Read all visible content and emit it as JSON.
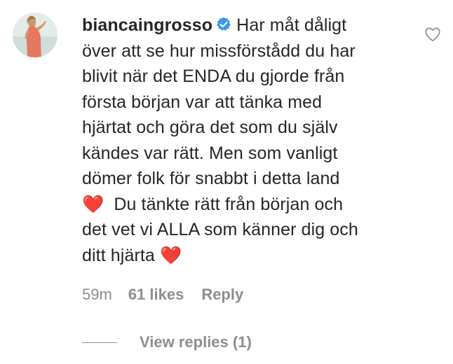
{
  "comment": {
    "username": "biancaingrosso",
    "verified_icon": "verified-badge-icon",
    "text_lines": [
      "Har måt dåligt",
      "över att se hur missförstådd du har",
      "blivit när det ENDA du gjorde från",
      "första början var att tänka med",
      "hjärtat och göra det som du själv",
      "kändes var rätt. Men som vanligt",
      "dömer folk för snabbt i detta land",
      "❤️  Du tänkte rätt från början och",
      "det vet vi ALLA som känner dig och",
      "ditt hjärta ❤️"
    ],
    "time": "59m",
    "likes": "61 likes",
    "reply_label": "Reply",
    "view_replies_label": "View replies (1)",
    "like_icon": "heart-outline-icon",
    "accent_color": "#3897f0",
    "muted_color": "#8e8e8e"
  }
}
